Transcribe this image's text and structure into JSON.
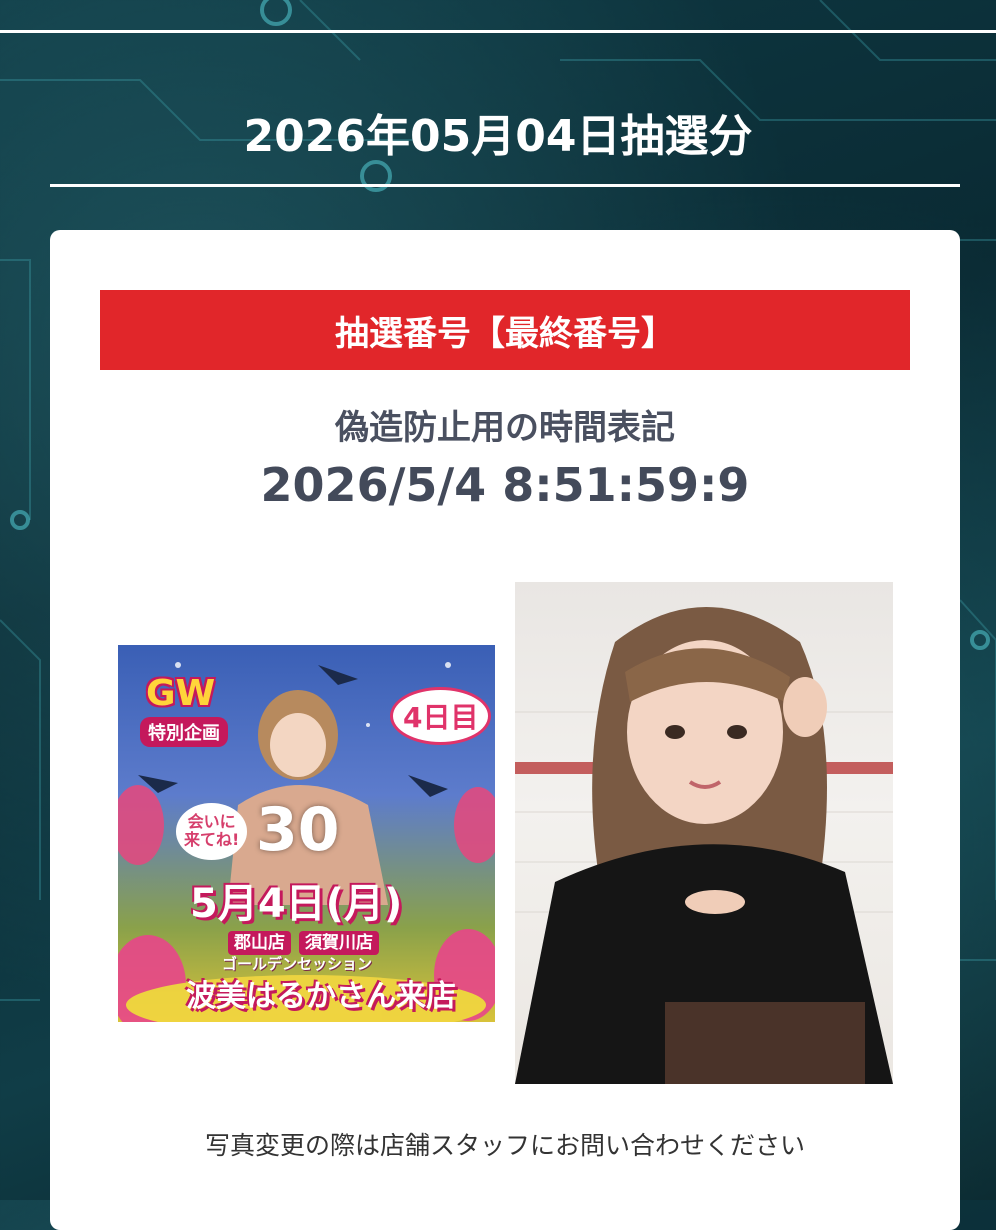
{
  "header": {
    "date_title": "2026年05月04日抽選分"
  },
  "card": {
    "banner_label": "抽選番号【最終番号】",
    "timestamp_label": "偽造防止用の時間表記",
    "timestamp_value": "2026/5/4 8:51:59:9",
    "footer_note": "写真変更の際は店舗スタッフにお問い合わせください"
  },
  "poster": {
    "gw": "GW",
    "special": "特別企画",
    "day_badge": "4日目",
    "meet_bubble_line1": "会いに",
    "meet_bubble_line2": "来てね!",
    "number": "30",
    "date": "5月4日(月)",
    "store1": "郡山店",
    "store2": "須賀川店",
    "event": "ゴールデンセッション",
    "name": "波美はるかさん来店"
  },
  "colors": {
    "banner": "#e1262a",
    "heading_text": "#ffffff",
    "timestamp_text": "#434a5a",
    "background": "#0f3a44"
  }
}
